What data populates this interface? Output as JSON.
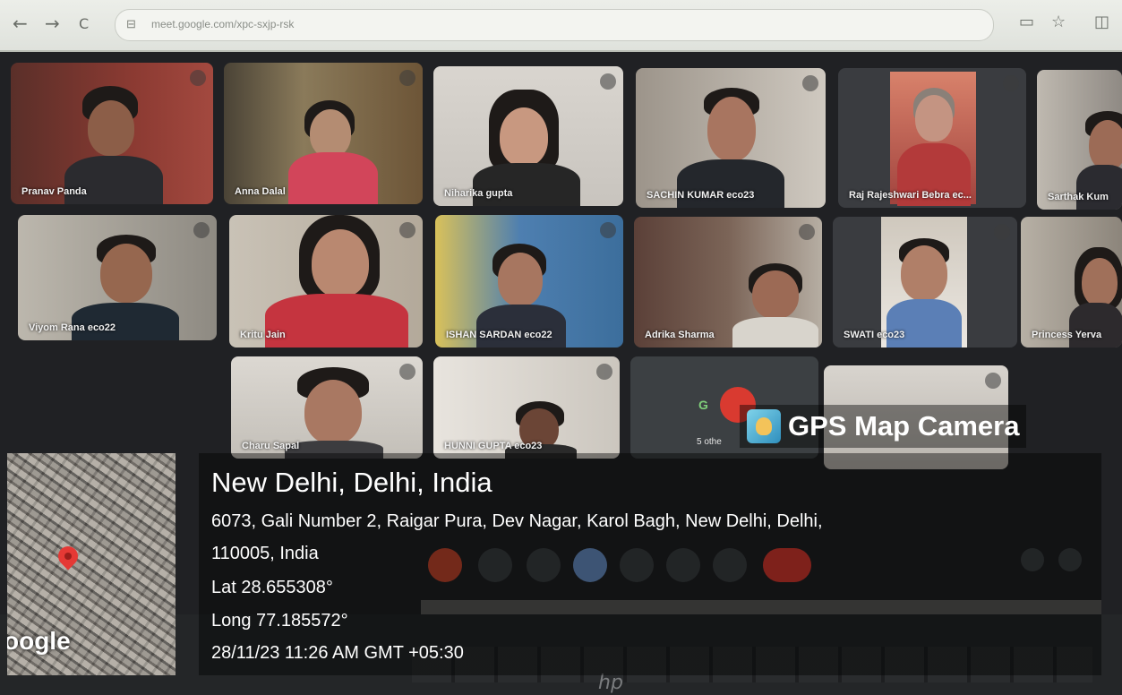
{
  "browser": {
    "back": "←",
    "forward": "→",
    "reload": "C",
    "url": "meet.google.com/xpc-sxjp-rsk"
  },
  "meet": {
    "tiles": [
      {
        "name": "Pranav Panda"
      },
      {
        "name": "Anna Dalal"
      },
      {
        "name": "Niharika gupta"
      },
      {
        "name": "SACHIN KUMAR eco23"
      },
      {
        "name": "Raj Rajeshwari Bebra ec..."
      },
      {
        "name": "Sarthak Kum"
      },
      {
        "name": "Viyom Rana eco22"
      },
      {
        "name": "Kritu Jain"
      },
      {
        "name": "ISHAN SARDAN eco22"
      },
      {
        "name": "Adrika Sharma"
      },
      {
        "name": "SWATI eco23"
      },
      {
        "name": "Princess Yerva"
      },
      {
        "name": "Charu Sapal"
      },
      {
        "name": "HUNNI GUPTA eco23"
      }
    ],
    "others_avatar": "G",
    "others_label": "5 othe"
  },
  "gps": {
    "title": "GPS Map Camera",
    "city": "New Delhi, Delhi, India",
    "address_line1": "6073, Gali Number 2, Raigar Pura, Dev Nagar, Karol Bagh, New Delhi, Delhi,",
    "address_line2": "110005, India",
    "lat": "Lat 28.655308°",
    "long": "Long 77.185572°",
    "datetime": "28/11/23 11:26 AM GMT +05:30",
    "map_logo": "oogle"
  },
  "laptop": {
    "brand": "hp"
  }
}
